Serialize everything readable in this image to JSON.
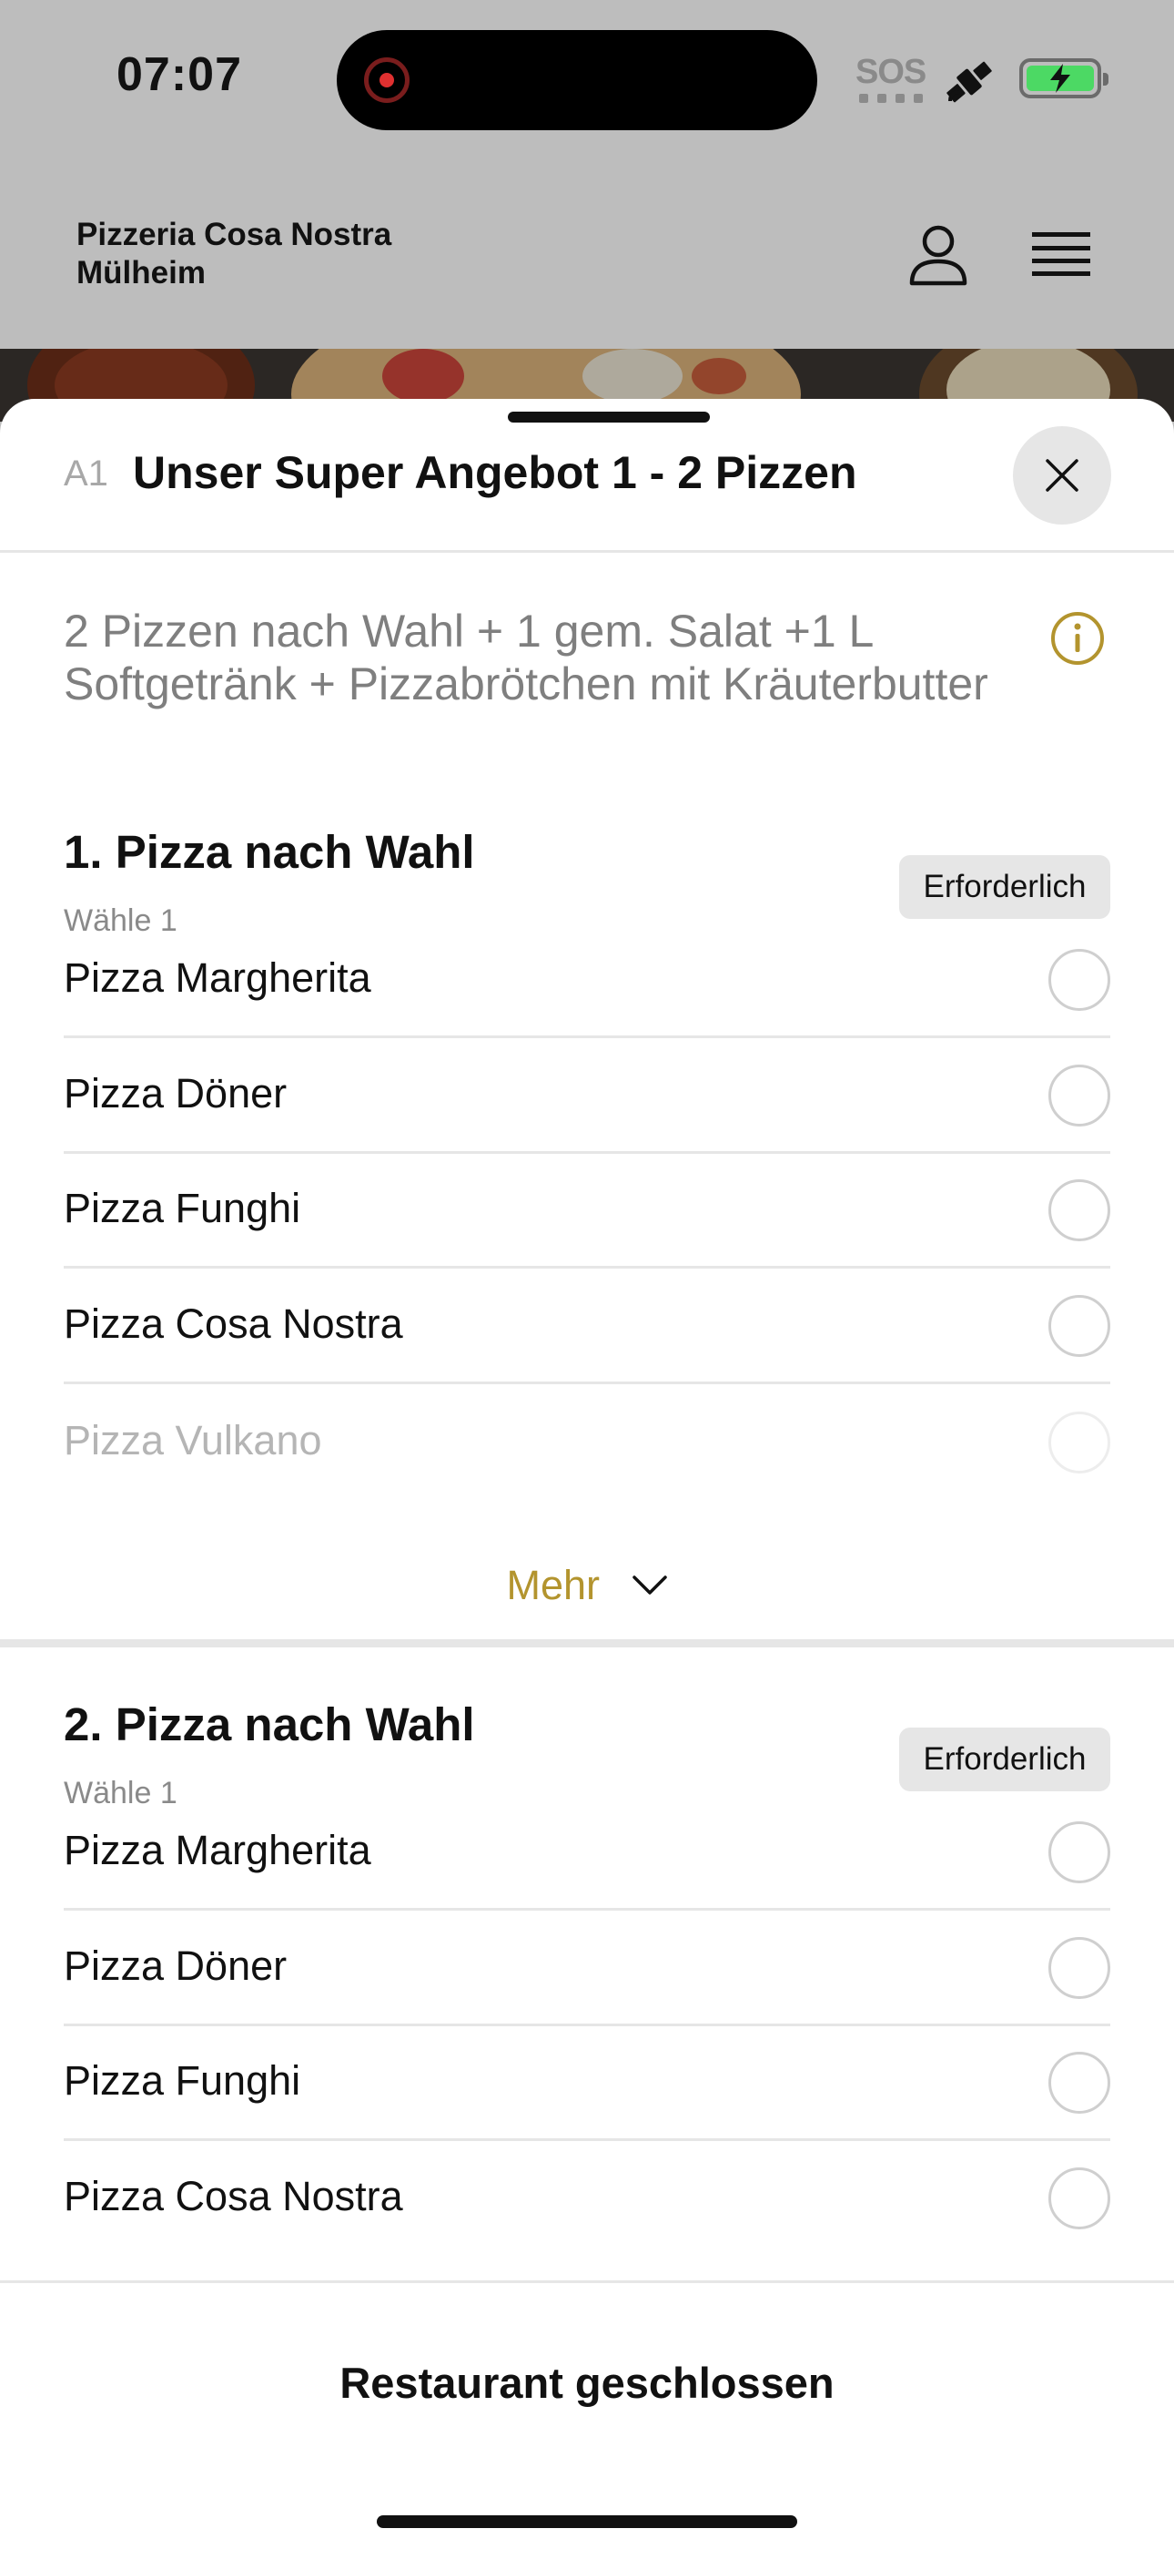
{
  "status_bar": {
    "time": "07:07",
    "sos": "SOS",
    "battery_color": "#4cd964"
  },
  "header": {
    "restaurant_name": "Pizzeria Cosa Nostra Mülheim",
    "icons": [
      "user-icon",
      "hamburger-menu-icon"
    ]
  },
  "sheet": {
    "code": "A1",
    "title": "Unser Super Angebot 1 - 2 Pizzen",
    "description": "2 Pizzen nach Wahl + 1 gem. Salat +1 L Softgetränk  + Pizzabrötchen mit Kräuterbutter",
    "accent_color": "#b3942e"
  },
  "sections": [
    {
      "title": "1. Pizza nach Wahl",
      "subtitle": "Wähle 1",
      "badge": "Erforderlich",
      "options": [
        "Pizza Margherita",
        "Pizza Döner",
        "Pizza Funghi",
        "Pizza Cosa Nostra",
        "Pizza Vulkano"
      ],
      "more_label": "Mehr"
    },
    {
      "title": "2. Pizza nach Wahl",
      "subtitle": "Wähle 1",
      "badge": "Erforderlich",
      "options": [
        "Pizza Margherita",
        "Pizza Döner",
        "Pizza Funghi",
        "Pizza Cosa Nostra"
      ]
    }
  ],
  "footer": {
    "label": "Restaurant geschlossen"
  }
}
